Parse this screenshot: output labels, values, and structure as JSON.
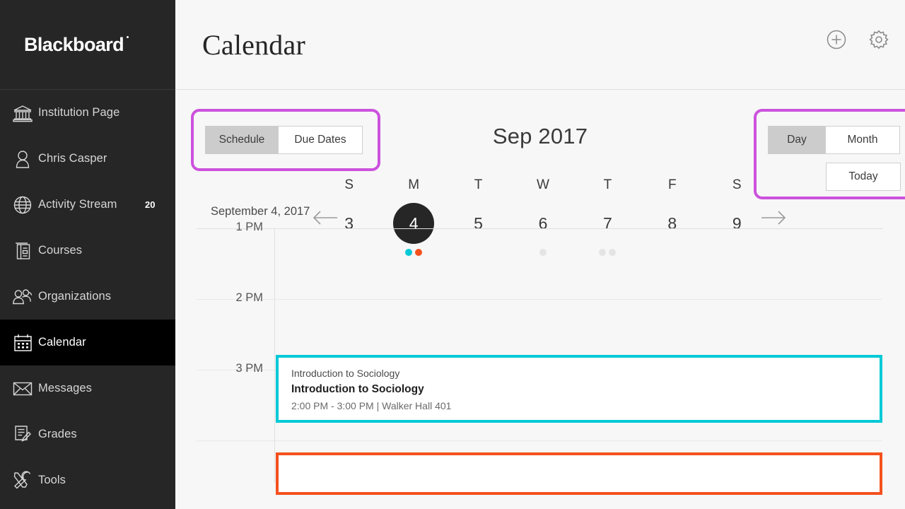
{
  "brand": {
    "name": "Blackboard"
  },
  "sidebar": {
    "items": [
      {
        "label": "Institution Page",
        "icon": "institution-icon",
        "active": false,
        "badge": ""
      },
      {
        "label": "Chris Casper",
        "icon": "user-icon",
        "active": false,
        "badge": ""
      },
      {
        "label": "Activity Stream",
        "icon": "globe-icon",
        "active": false,
        "badge": "20"
      },
      {
        "label": "Courses",
        "icon": "courses-icon",
        "active": false,
        "badge": ""
      },
      {
        "label": "Organizations",
        "icon": "organizations-icon",
        "active": false,
        "badge": ""
      },
      {
        "label": "Calendar",
        "icon": "calendar-icon",
        "active": true,
        "badge": ""
      },
      {
        "label": "Messages",
        "icon": "envelope-icon",
        "active": false,
        "badge": ""
      },
      {
        "label": "Grades",
        "icon": "grades-icon",
        "active": false,
        "badge": ""
      },
      {
        "label": "Tools",
        "icon": "tools-icon",
        "active": false,
        "badge": ""
      }
    ]
  },
  "header": {
    "title": "Calendar",
    "actions": [
      {
        "name": "add-event-button",
        "icon": "plus-circle-icon"
      },
      {
        "name": "calendar-settings-button",
        "icon": "gear-icon"
      }
    ]
  },
  "controls": {
    "schedule_toggle": {
      "options": [
        {
          "label": "Schedule",
          "selected": true
        },
        {
          "label": "Due Dates",
          "selected": false
        }
      ]
    },
    "view_toggle": {
      "options": [
        {
          "label": "Day",
          "selected": true
        },
        {
          "label": "Month",
          "selected": false
        }
      ]
    },
    "today_button": {
      "label": "Today"
    },
    "highlight_color": "#cc52dd"
  },
  "datebar": {
    "month_label": "Sep 2017",
    "prev_label": "Previous week",
    "next_label": "Next week",
    "days": [
      {
        "dow": "S",
        "num": "3",
        "today": false,
        "dots": []
      },
      {
        "dow": "M",
        "num": "4",
        "today": true,
        "dots": [
          "#00c9d7",
          "#f4511e"
        ]
      },
      {
        "dow": "T",
        "num": "5",
        "today": false,
        "dots": []
      },
      {
        "dow": "W",
        "num": "6",
        "today": false,
        "dots": [
          "#e4e4e4"
        ]
      },
      {
        "dow": "T",
        "num": "7",
        "today": false,
        "dots": [
          "#e4e4e4",
          "#e4e4e4"
        ]
      },
      {
        "dow": "F",
        "num": "8",
        "today": false,
        "dots": []
      },
      {
        "dow": "S",
        "num": "9",
        "today": false,
        "dots": []
      }
    ]
  },
  "schedule": {
    "date_heading": "September 4, 2017",
    "hours": [
      {
        "label": "1 PM"
      },
      {
        "label": "2 PM"
      },
      {
        "label": "3 PM"
      },
      {
        "label": ""
      }
    ],
    "events": [
      {
        "course": "Introduction to Sociology",
        "title": "Introduction to Sociology",
        "meta": "2:00 PM - 3:00 PM | Walker Hall 401",
        "color": "#00c9d7"
      },
      {
        "course": "",
        "title": "",
        "meta": "",
        "color": "#f4511e"
      }
    ]
  }
}
